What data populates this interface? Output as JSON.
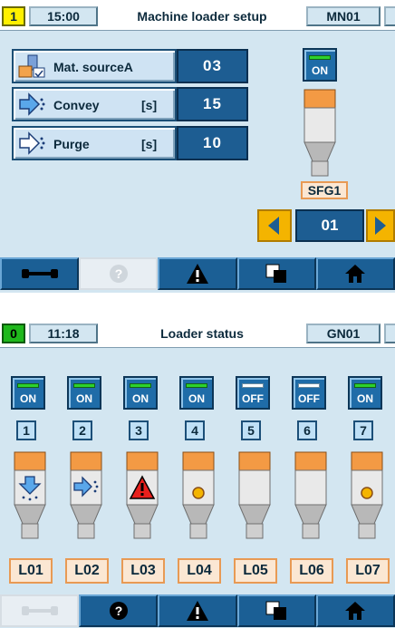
{
  "top": {
    "header": {
      "screen_number": "1",
      "time": "15:00",
      "title": "Machine loader setup",
      "code": "MN01"
    },
    "params": [
      {
        "icon": "material-source-icon",
        "label": "Mat. sourceA",
        "unit": "",
        "value": "03"
      },
      {
        "icon": "convey-arrow-icon",
        "label": "Convey",
        "unit": "[s]",
        "value": "15"
      },
      {
        "icon": "purge-arrow-icon",
        "label": "Purge",
        "unit": "[s]",
        "value": "10"
      }
    ],
    "on_button": {
      "label": "ON",
      "state": "on"
    },
    "hopper_label": "SFG1",
    "page": "01"
  },
  "bottom": {
    "header": {
      "screen_number": "0",
      "time": "11:18",
      "title": "Loader status",
      "code": "GN01"
    },
    "stations": [
      {
        "num": "1",
        "state": "ON",
        "icon": "convey-down-icon",
        "label": "L01"
      },
      {
        "num": "2",
        "state": "ON",
        "icon": "convey-right-icon",
        "label": "L02"
      },
      {
        "num": "3",
        "state": "ON",
        "icon": "alarm-icon",
        "label": "L03"
      },
      {
        "num": "4",
        "state": "ON",
        "icon": "ready-dot-icon",
        "label": "L04"
      },
      {
        "num": "5",
        "state": "OFF",
        "icon": "",
        "label": "L05"
      },
      {
        "num": "6",
        "state": "OFF",
        "icon": "",
        "label": "L06"
      },
      {
        "num": "7",
        "state": "ON",
        "icon": "ready-dot-icon",
        "label": "L07"
      }
    ]
  },
  "nav_top": [
    "wrench-icon",
    "help-icon",
    "warning-icon",
    "copy-icon",
    "home-icon"
  ],
  "nav_bottom": [
    "wrench-icon",
    "help-icon",
    "warning-icon",
    "copy-icon",
    "home-icon"
  ],
  "colors": {
    "panel": "#d3e6f1",
    "value_blue": "#1d5d92",
    "accent_orange": "#f39a44",
    "on_green": "#2dd22d",
    "yellow": "#f4b400"
  }
}
